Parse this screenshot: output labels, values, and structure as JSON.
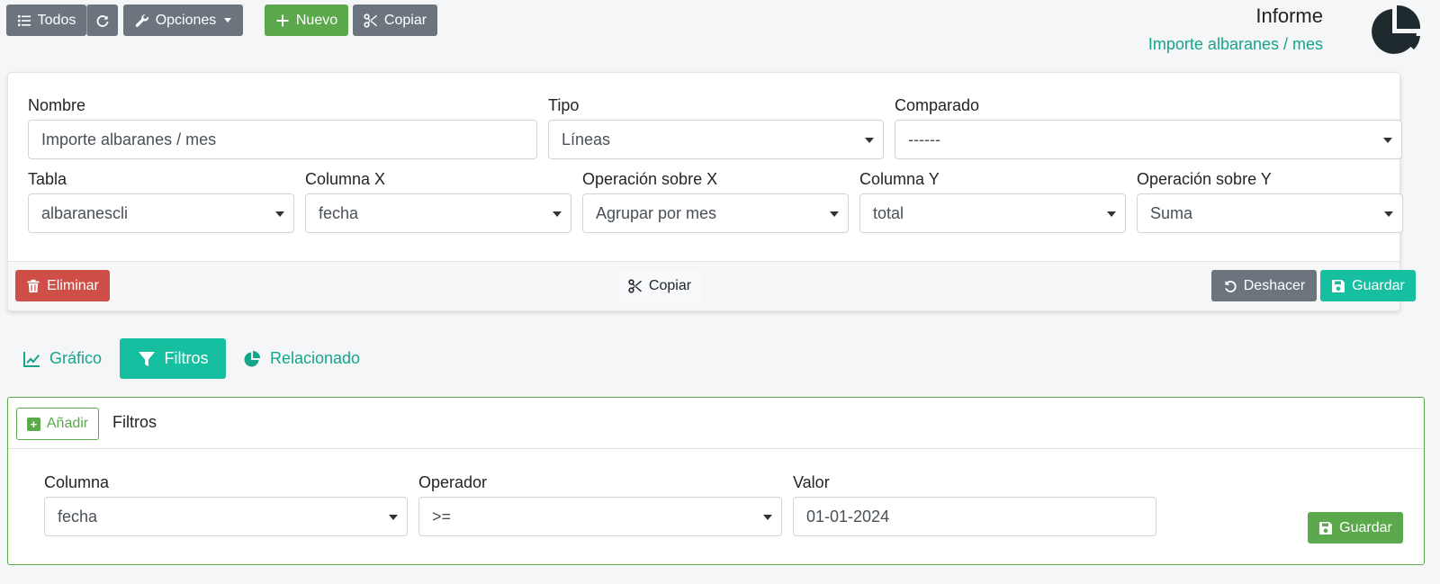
{
  "toolbar": {
    "todos_label": "Todos",
    "opciones_label": "Opciones",
    "nuevo_label": "Nuevo",
    "copiar_label": "Copiar"
  },
  "header": {
    "title": "Informe",
    "subtitle": "Importe albaranes / mes"
  },
  "form": {
    "nombre": {
      "label": "Nombre",
      "value": "Importe albaranes / mes"
    },
    "tipo": {
      "label": "Tipo",
      "value": "Líneas"
    },
    "comparado": {
      "label": "Comparado",
      "value": "------"
    },
    "tabla": {
      "label": "Tabla",
      "value": "albaranescli"
    },
    "columna_x": {
      "label": "Columna X",
      "value": "fecha"
    },
    "operacion_x": {
      "label": "Operación sobre X",
      "value": "Agrupar por mes"
    },
    "columna_y": {
      "label": "Columna Y",
      "value": "total"
    },
    "operacion_y": {
      "label": "Operación sobre Y",
      "value": "Suma"
    }
  },
  "footer": {
    "eliminar_label": "Eliminar",
    "copiar_label": "Copiar",
    "deshacer_label": "Deshacer",
    "guardar_label": "Guardar"
  },
  "tabs": [
    {
      "label": "Gráfico",
      "icon": "line-chart-icon",
      "active": false
    },
    {
      "label": "Filtros",
      "icon": "filter-icon",
      "active": true
    },
    {
      "label": "Relacionado",
      "icon": "pie-chart-icon",
      "active": false
    }
  ],
  "filters": {
    "add_label": "Añadir",
    "title": "Filtros",
    "columna": {
      "label": "Columna",
      "value": "fecha"
    },
    "operador": {
      "label": "Operador",
      "value": ">="
    },
    "valor": {
      "label": "Valor",
      "value": "01-01-2024"
    },
    "guardar_label": "Guardar"
  },
  "colors": {
    "accent": "#17bfa1",
    "success": "#5ba94c",
    "danger": "#cf4e47",
    "secondary": "#6c757d",
    "link": "#17a589"
  }
}
